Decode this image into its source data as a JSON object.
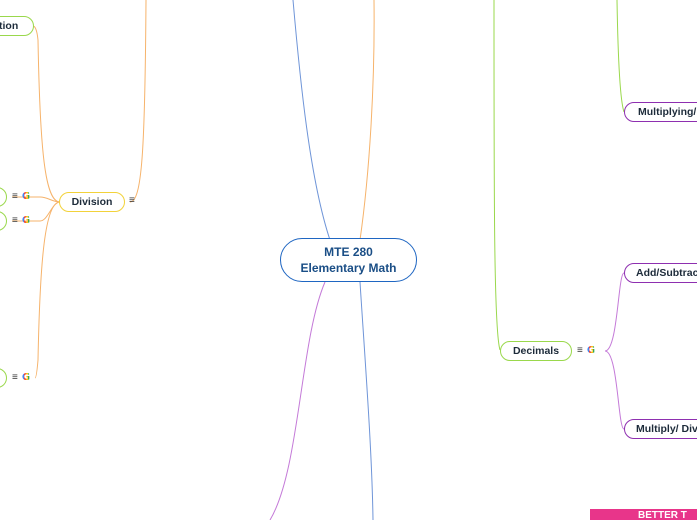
{
  "diagram": {
    "center": {
      "line1": "MTE 280",
      "line2": "Elementary Math"
    },
    "nodes": {
      "top_left_partial": "tion",
      "division": "Division",
      "decimals": "Decimals",
      "multiplying": "Multiplying/",
      "add_subtract": "Add/Subtrac",
      "multiply_divide": "Multiply/ Div"
    },
    "icons": {
      "menu": "≡",
      "google": "G"
    },
    "banner": "BETTER T"
  },
  "colors": {
    "center_border": "#1f66c2",
    "green": "#9ad84c",
    "yellow": "#f2d23a",
    "purple": "#8e2fb0",
    "orange_edge": "#f6b36b",
    "blue_edge": "#6f95d8",
    "banner": "#e8358a"
  }
}
